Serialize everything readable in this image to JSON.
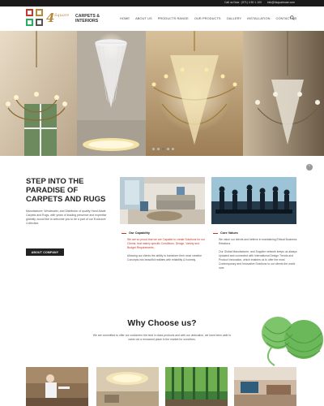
{
  "topbar": {
    "phone": "Call us Now : (971) 4 50 1 100",
    "email": "info@4squareuae.com"
  },
  "logo": {
    "mark": "4",
    "mark_script": "Square",
    "name_line1": "CARPETS &",
    "name_line2": "INTERIORS"
  },
  "nav": {
    "items": [
      "HOME",
      "ABOUT US",
      "PRODUCTS RANGE",
      "OUR PRODUCTS",
      "GALLERY",
      "INSTALLATION",
      "CONTACT US"
    ],
    "search_icon": "search-icon"
  },
  "hero": {
    "slide_count": 5,
    "active_slide": 3
  },
  "intro": {
    "title": "STEP INTO THE PARADISE OF CARPETS AND RUGS",
    "text": "Manufacturer, Wholesaler, and Distributor of quality Hand-Made Carpets and Rugs, with years of leading presence and expertise globally, would like to welcome you to be a part of our Exclusive Collection.",
    "button": "ABOUT COMPANY"
  },
  "features": [
    {
      "title": "Our Capability",
      "p1": "We are so proud that we are Capable to create Solutions for our Clients, that mainly specific Conditions, Design, Variety and Budget Requirements.",
      "p2": "Allowing our clients the ability to transform their most creative Concepts into beautiful realities with reliability & honesty."
    },
    {
      "title": "Core Values",
      "p1": "We value our clients and believe in maintaining Ethical Business Relations.",
      "p2": "Our Global Manufacturer, and Supplier network keeps us always Updated and connected with International Design Trends and Product Innovation, which enables us to offer the most Contemporary and Innovative Solutions to our clients the world over."
    }
  ],
  "scroll_icon": "chevron-up-icon",
  "why": {
    "title": "Why Choose us?",
    "text": "We are committed to offer our customers the best in class products and with our dedication, we have been able to carve out a renowned place in the market for ourselves."
  },
  "colors": {
    "accent_red": "#c0392b",
    "logo_gold": "#b8893a",
    "topbar": "#1a1a1a",
    "button": "#222222"
  }
}
